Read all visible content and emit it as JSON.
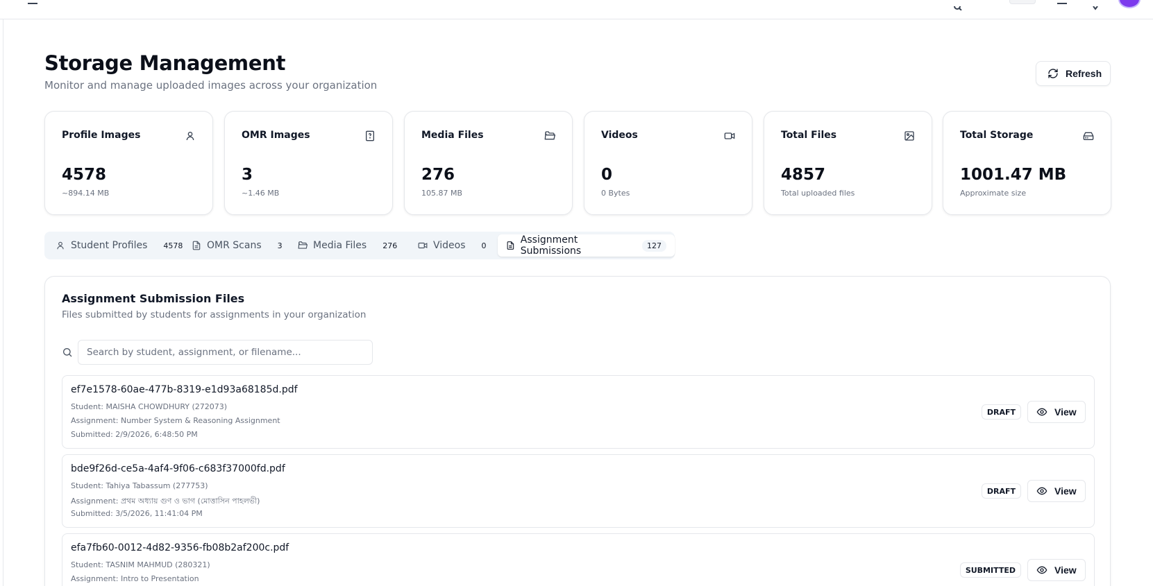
{
  "header": {
    "title": "Storage Management",
    "subtitle": "Monitor and manage uploaded images across your organization",
    "refresh_label": "Refresh"
  },
  "stats": [
    {
      "label": "Profile Images",
      "value": "4578",
      "sub": "~894.14 MB",
      "icon": "user-icon"
    },
    {
      "label": "OMR Images",
      "value": "3",
      "sub": "~1.46 MB",
      "icon": "file-question-icon"
    },
    {
      "label": "Media Files",
      "value": "276",
      "sub": "105.87 MB",
      "icon": "folder-open-icon"
    },
    {
      "label": "Videos",
      "value": "0",
      "sub": "0 Bytes",
      "icon": "video-icon"
    },
    {
      "label": "Total Files",
      "value": "4857",
      "sub": "Total uploaded files",
      "icon": "image-icon"
    },
    {
      "label": "Total Storage",
      "value": "1001.47 MB",
      "sub": "Approximate size",
      "icon": "hard-drive-icon"
    }
  ],
  "tabs": [
    {
      "label": "Student Profiles",
      "count": "4578",
      "icon": "user-icon"
    },
    {
      "label": "OMR Scans",
      "count": "3",
      "icon": "file-text-icon"
    },
    {
      "label": "Media Files",
      "count": "276",
      "icon": "folder-open-icon"
    },
    {
      "label": "Videos",
      "count": "0",
      "icon": "video-icon"
    },
    {
      "label": "Assignment Submissions",
      "count": "127",
      "icon": "file-text-icon",
      "active": true
    }
  ],
  "panel": {
    "title": "Assignment Submission Files",
    "subtitle": "Files submitted by students for assignments in your organization",
    "search_placeholder": "Search by student, assignment, or filename..."
  },
  "files": [
    {
      "name": "ef7e1578-60ae-477b-8319-e1d93a68185d.pdf",
      "student": "Student: MAISHA CHOWDHURY (272073)",
      "assignment": "Assignment: Number System & Reasoning Assignment",
      "submitted": "Submitted: 2/9/2026, 6:48:50 PM",
      "status": "DRAFT",
      "view_label": "View"
    },
    {
      "name": "bde9f26d-ce5a-4af4-9f06-c683f37000fd.pdf",
      "student": "Student: Tahiya Tabassum (277753)",
      "assignment": "Assignment: প্রথম অধ্যায় গুণ ও ভাগ (মোত্তাসিন পাহলভী)",
      "submitted": "Submitted: 3/5/2026, 11:41:04 PM",
      "status": "DRAFT",
      "view_label": "View"
    },
    {
      "name": "efa7fb60-0012-4d82-9356-fb08b2af200c.pdf",
      "student": "Student: TASNIM MAHMUD (280321)",
      "assignment": "Assignment: Intro to Presentation",
      "submitted": "",
      "status": "SUBMITTED",
      "view_label": "View"
    }
  ],
  "colors": {
    "accent": "#7c3aed",
    "border": "#e5e7eb",
    "muted_text": "#6b7280",
    "tab_bg": "#f1f5f9"
  }
}
